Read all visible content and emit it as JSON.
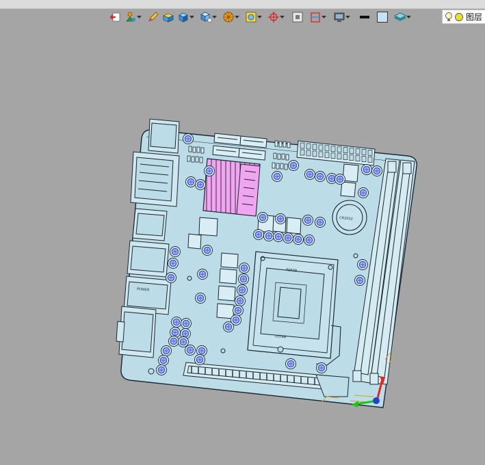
{
  "toolbar": {
    "tools": [
      {
        "icon": "exit-sketch-icon",
        "has_menu": false
      },
      {
        "icon": "constraint-icon",
        "has_menu": true
      },
      {
        "icon": "pencil-icon",
        "has_menu": false
      },
      {
        "icon": "box-feature-icon",
        "has_menu": false
      },
      {
        "icon": "cube-icon",
        "has_menu": true
      },
      {
        "icon": "view-orientation-icon",
        "has_menu": true
      },
      {
        "icon": "render-style-icon",
        "has_menu": true
      },
      {
        "icon": "zoom-fit-icon",
        "has_menu": true
      },
      {
        "icon": "origin-icon",
        "has_menu": true
      },
      {
        "icon": "section-view-icon",
        "has_menu": false
      },
      {
        "icon": "clipping-plane-icon",
        "has_menu": true
      },
      {
        "icon": "display-monitor-icon",
        "has_menu": true
      },
      {
        "icon": "line-color-icon",
        "has_menu": false
      },
      {
        "icon": "fill-color-icon",
        "has_menu": false
      },
      {
        "icon": "layer-tool-icon",
        "has_menu": true
      }
    ],
    "layer_label": "图层",
    "colors": {
      "toolbar_bg": "#a5a5a5",
      "accent_blue": "#3d8fd8",
      "accent_orange": "#e59a1a",
      "accent_red": "#d8262d"
    }
  },
  "model": {
    "chip_markings": [
      "PSR0B",
      "LGY8B"
    ],
    "capacitor_label": "CR2032",
    "port_label": "POWER",
    "colors": {
      "board": "#bcdde8",
      "outline": "#1b2730",
      "heatsink": "#f1a5f0",
      "capacitor_top": "#3f54d8",
      "background": "#a5a5a5",
      "axis_x": "#18c818",
      "axis_y": "#e0261f",
      "axis_z": "#2244cc"
    }
  }
}
